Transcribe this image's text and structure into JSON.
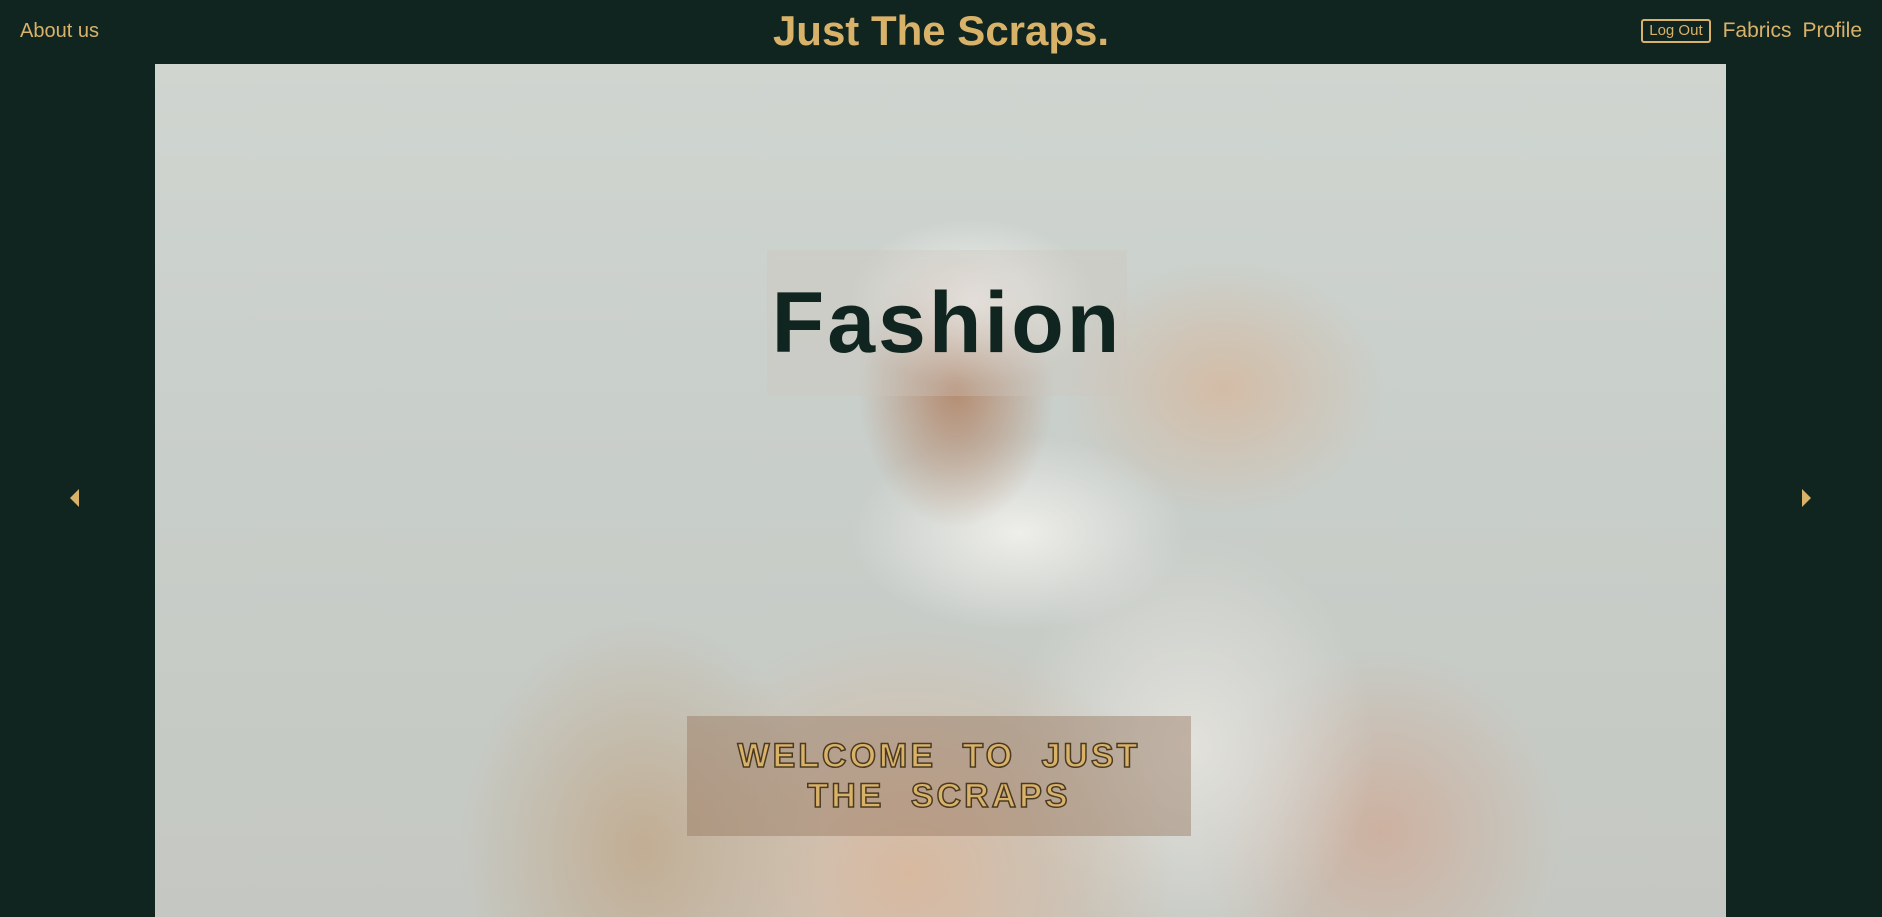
{
  "header": {
    "about_label": "About us",
    "brand_title": "Just The Scraps.",
    "logout_label": "Log Out",
    "fabrics_label": "Fabrics",
    "profile_label": "Profile"
  },
  "hero": {
    "title": "Fashion",
    "welcome": "WELCOME TO JUST THE SCRAPS",
    "prev_icon": "caret-left-icon",
    "next_icon": "caret-right-icon"
  },
  "colors": {
    "background": "#112520",
    "accent": "#d9b26a"
  }
}
